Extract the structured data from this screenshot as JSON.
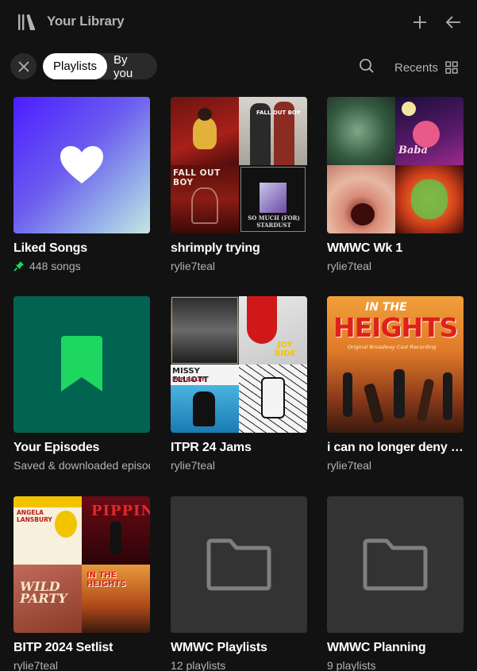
{
  "header": {
    "title": "Your Library",
    "library_icon": "library-icon",
    "create_icon": "plus-icon",
    "collapse_icon": "arrow-left-icon"
  },
  "filters": {
    "clear_icon": "close-icon",
    "chips": [
      "Playlists",
      "By you"
    ],
    "active_chip": "Playlists",
    "sort_label": "Recents",
    "search_icon": "search-icon",
    "view_icon": "grid-view-icon"
  },
  "colors": {
    "background": "#121212",
    "accent_green": "#1ed760",
    "episodes_bg": "#006450",
    "subtext": "#b3b3b3"
  },
  "cards": [
    {
      "title": "Liked Songs",
      "subtitle": "448 songs",
      "pinned": true,
      "art": "heart-icon"
    },
    {
      "title": "shrimply trying",
      "subtitle": "rylie7teal",
      "art": "mosaic",
      "art_texts": [
        "FALL OUT BOY",
        "FALL OUT BOY",
        "SO MUCH (FOR) STARDUST"
      ]
    },
    {
      "title": "WMWC Wk 1",
      "subtitle": "rylie7teal",
      "art": "mosaic",
      "art_texts": [
        "Baba"
      ]
    },
    {
      "title": "Your Episodes",
      "subtitle": "Saved & downloaded episodes",
      "art": "bookmark-icon"
    },
    {
      "title": "ITPR 24 Jams",
      "subtitle": "rylie7teal",
      "art": "mosaic",
      "art_texts": [
        "JOY RIDE",
        "MISSY ELLIOTT",
        "PEP RALLY"
      ]
    },
    {
      "title": "i can no longer deny that",
      "subtitle": "rylie7teal",
      "art": "cover",
      "art_texts": [
        "IN THE",
        "HEIGHTS",
        "Original Broadway Cast Recording"
      ]
    },
    {
      "title": "BITP 2024 Setlist",
      "subtitle": "rylie7teal",
      "art": "mosaic",
      "art_texts": [
        "ANGELA LANSBURY",
        "PIPPIN",
        "WILD PARTY",
        "IN THE HEIGHTS"
      ]
    },
    {
      "title": "WMWC Playlists",
      "subtitle": "12 playlists",
      "art": "folder-icon"
    },
    {
      "title": "WMWC Planning",
      "subtitle": "9 playlists",
      "art": "folder-icon"
    }
  ]
}
